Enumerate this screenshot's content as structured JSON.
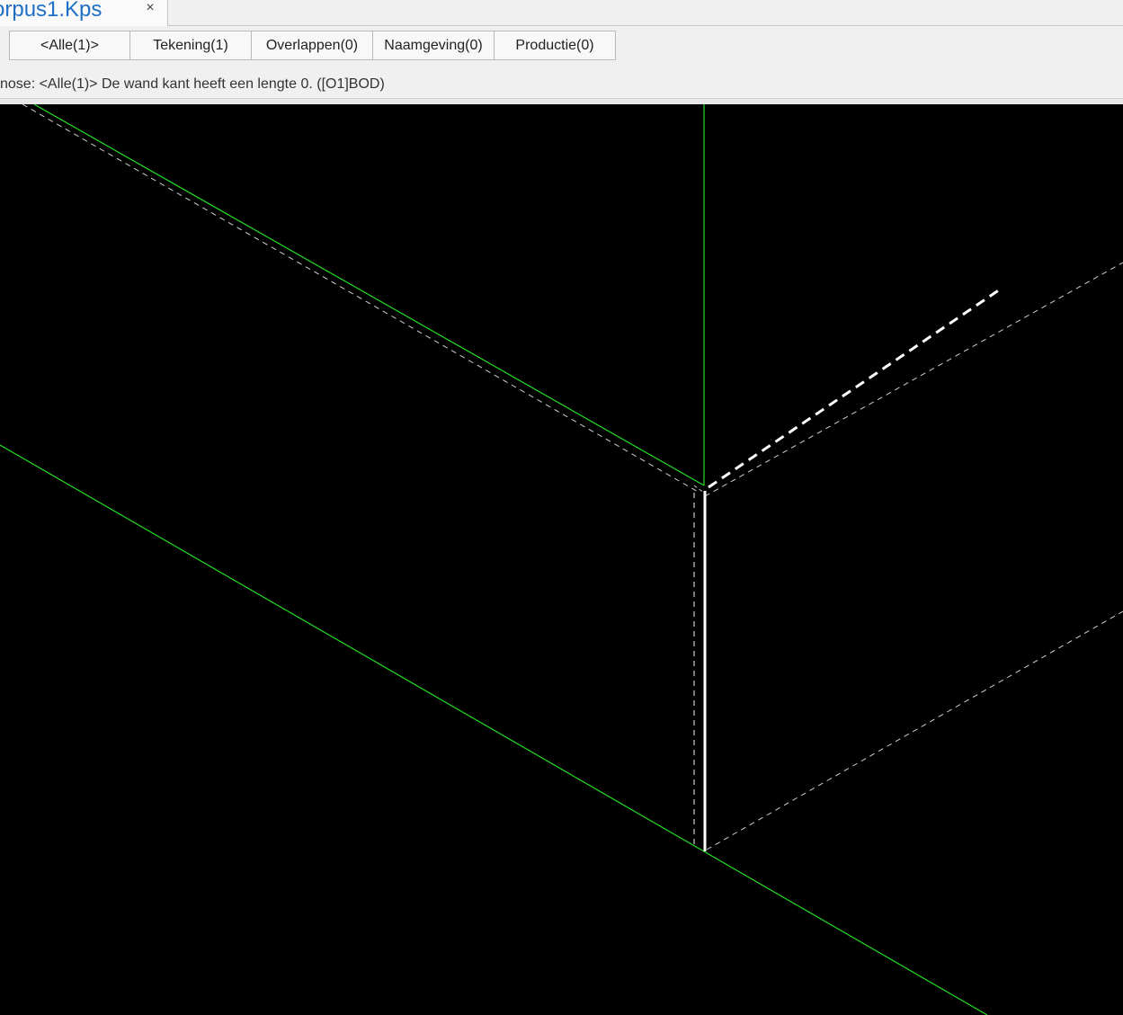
{
  "document_tab": {
    "title": "orpus1.Kps",
    "close_symbol": "×"
  },
  "filter_bar": {
    "buttons": [
      {
        "label": "<Alle(1)>"
      },
      {
        "label": "Tekening(1)"
      },
      {
        "label": "Overlappen(0)"
      },
      {
        "label": "Naamgeving(0)"
      },
      {
        "label": "Productie(0)"
      }
    ]
  },
  "status": {
    "text": "nose: <Alle(1)> De wand kant heeft een lengte 0. ([O1]BOD)"
  },
  "colors": {
    "canvas_background": "#000000",
    "green_edge": "#22dd22",
    "white_edge": "#ffffff",
    "tab_title": "#1f6fc5"
  }
}
